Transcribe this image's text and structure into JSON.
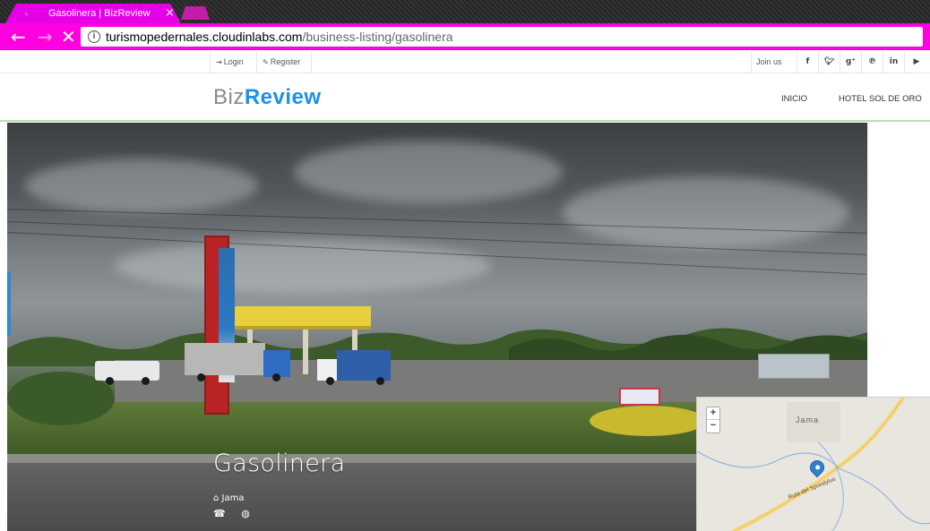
{
  "browser": {
    "tab_title": "Gasolinera | BizReview",
    "tab_favicon": "loading-icon",
    "tab_close": "×",
    "back_glyph": "←",
    "forward_glyph": "→",
    "stop_glyph": "✕",
    "info_glyph": "i",
    "url_host": "turismopedernales.cloudinlabs.com",
    "url_path": "/business-listing/gasolinera",
    "colors": {
      "tab": "#e600e6",
      "toolbar": "#ff00e0"
    }
  },
  "topbar": {
    "login_icon": "sign-in-icon",
    "login_label": "Login",
    "register_icon": "pencil-icon",
    "register_label": "Register",
    "join_label": "Join us on",
    "social": [
      {
        "name": "facebook-icon",
        "glyph": "f"
      },
      {
        "name": "twitter-icon",
        "glyph": "🐦"
      },
      {
        "name": "google-plus-icon",
        "glyph": "g⁺"
      },
      {
        "name": "pinterest-icon",
        "glyph": "℗"
      },
      {
        "name": "linkedin-icon",
        "glyph": "in"
      },
      {
        "name": "youtube-icon",
        "glyph": "▶"
      }
    ]
  },
  "header": {
    "logo_part1": "Biz",
    "logo_part2": "Review",
    "nav": [
      {
        "label": "INICIO"
      },
      {
        "label": "HOTEL SOL DE ORO"
      }
    ],
    "colors": {
      "logo_accent": "#1e90e8",
      "logo_gray": "#8a8a8a"
    }
  },
  "listing": {
    "name": "Gasolinera",
    "location": "Jama",
    "location_icon": "home-icon",
    "phone_icon": "phone-icon",
    "web_icon": "globe-icon"
  },
  "map": {
    "zoom_in": "+",
    "zoom_out": "−",
    "town_label": "Jama",
    "road_label": "Ruta del Spondylus"
  }
}
